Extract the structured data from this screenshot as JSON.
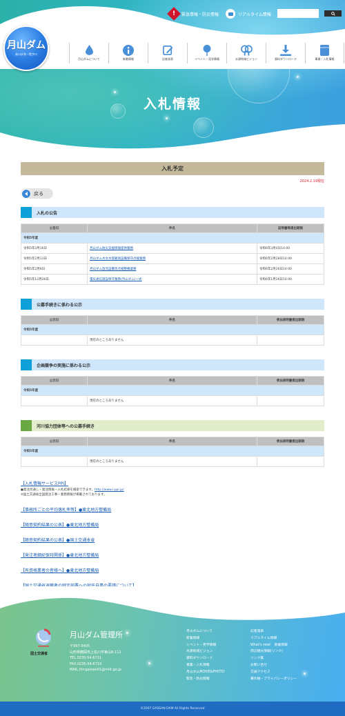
{
  "header": {
    "logo_title": "月山ダム",
    "logo_sub": "赤川水系一覧字川",
    "utility": [
      {
        "icon": "warning-icon",
        "label": "緊急情報・防災情報"
      },
      {
        "icon": "camera-icon",
        "label": "リアルタイム情報"
      }
    ],
    "search": {
      "value": "",
      "placeholder": "",
      "button_icon": "search-icon"
    },
    "nav": [
      {
        "icon": "water-drop-icon",
        "label": "月山ダムについて"
      },
      {
        "icon": "info-icon",
        "label": "新着情報"
      },
      {
        "icon": "edit-note-icon",
        "label": "記者発表"
      },
      {
        "icon": "map-pin-icon",
        "label": "イベント・見学情報"
      },
      {
        "icon": "trees-icon",
        "label": "水源地域ビジョン"
      },
      {
        "icon": "download-icon",
        "label": "資料ダウンロード"
      },
      {
        "icon": "document-box-icon",
        "label": "事業・入札情報"
      }
    ],
    "page_title": "入札情報"
  },
  "main": {
    "section_title": "入札予定",
    "as_of": "2024.2.19現在",
    "back_label": "戻る",
    "sections": [
      {
        "title": "入札の公告",
        "color": "blue",
        "columns": [
          "公告日",
          "件名",
          "証明書等提出期限"
        ],
        "year": "令和5年度",
        "rows": [
          {
            "date": "令和5年2月16日",
            "name": "月山ダム防災支援情報提供業務",
            "deadline": "令和6年3月4日14:00",
            "link": true
          },
          {
            "date": "令和5年2月13日",
            "name": "月山ダム水文水質観測設備保守点検業務",
            "deadline": "令和6年2月28日14:00",
            "link": true
          },
          {
            "date": "令和5年2月8日",
            "name": "月山ダム放流設備等点検整備業務",
            "deadline": "令和6年2月26日14:00",
            "link": true
          },
          {
            "date": "令和5年12月26日",
            "name": "電気通信施設保守業務(月山ダム)一式",
            "deadline": "令和6年1月26日14:00",
            "link": true
          }
        ]
      },
      {
        "title": "公募手続きに係わる公示",
        "color": "blue",
        "columns": [
          "公示日",
          "件名",
          "参加表明書提出期限"
        ],
        "year": "令和5年度",
        "rows": [
          {
            "date": "",
            "name": "現在のところありません",
            "deadline": "",
            "link": false
          }
        ]
      },
      {
        "title": "企画競争の実施に係わる公示",
        "color": "blue",
        "columns": [
          "公示日",
          "件名",
          "参加表明書提出期限"
        ],
        "year": "令和5年度",
        "rows": [
          {
            "date": "",
            "name": "現在のところありません",
            "deadline": "",
            "link": false
          }
        ]
      },
      {
        "title": "河川協力団体等への公募手続き",
        "color": "green",
        "columns": [
          "公示日",
          "件名",
          "参加表明書提出期限"
        ],
        "year": "令和5年度",
        "rows": [
          {
            "date": "",
            "name": "現在のところありません",
            "deadline": "",
            "link": false
          }
        ]
      }
    ],
    "ppi": {
      "title": "【入札情報サービスPPI】",
      "note1": "●発注見通し・発注情報・入札結果を検索できます。",
      "note1_link": "http://www.i-ppi.jp/",
      "note2": "※国土交通省全国発注工事・業務情報が掲載されております。"
    },
    "links": [
      "【事務所ごとの平均落札率等】●東北地方整備局",
      "【随意契約結果の公表】●東北地方整備局",
      "【随意契約結果の公表】●国土交通本省",
      "【発注者綱紀保持関係】●東北地方整備局",
      "【有資格業者の皆様へ】●東北地方整備局",
      "【国土交通省退職者の特定部署への就任自粛の要請について】"
    ]
  },
  "footer": {
    "ministry": "国土交通省",
    "office_name": "月山ダム管理所",
    "address_lines": [
      "〒997-0405",
      "山形県鶴岡市上名川字東山8-112",
      "TEL.0235-54-6711",
      "FAX.0235-54-6710",
      "MAIL.thr-gassan01@mlit.go.jp"
    ],
    "links_col1": [
      "月山ダムについて",
      "新着情報",
      "イベント・見学情報",
      "水源地域ビジョン",
      "資料ダウンロード",
      "事業・入札情報",
      "月山ダムMOVIE&PHOTO",
      "緊急・防災情報"
    ],
    "links_col2": [
      "記者発表",
      "リアルタイム情報",
      "What's new!　新着情報",
      "周辺観光情報(リンク)",
      "リンク集",
      "お問い合せ",
      "交通アクセス",
      "著作権・プライバシーポリシー"
    ],
    "copyright": "©2007 GASSAN DAM All Rights Reserved"
  }
}
